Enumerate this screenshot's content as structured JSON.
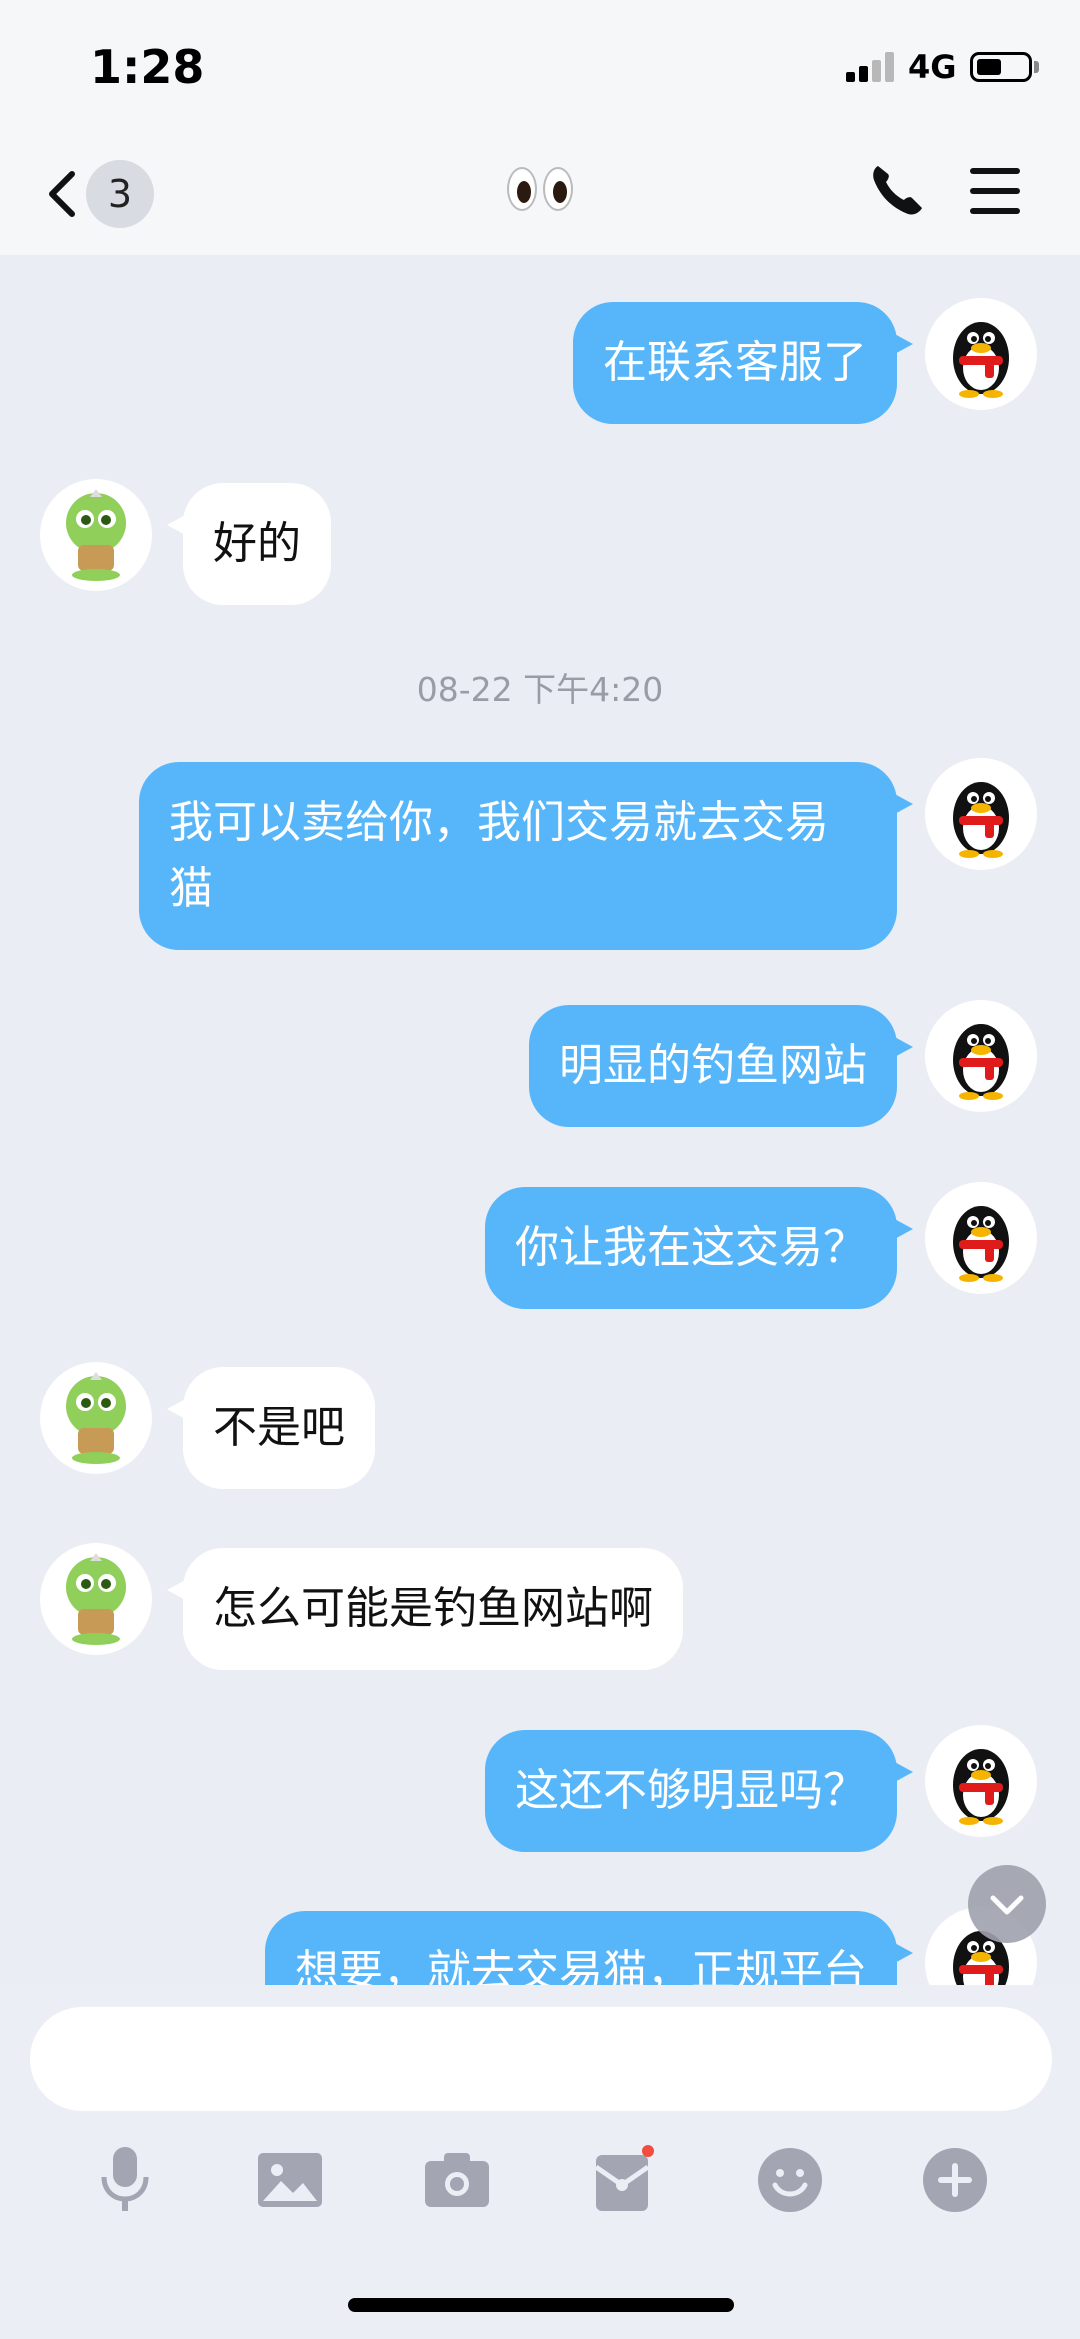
{
  "status_bar": {
    "time": "1:28",
    "network": "4G"
  },
  "nav": {
    "unread_count": "3",
    "title_icon": "eyes-emoji"
  },
  "messages": [
    {
      "side": "out",
      "text": "在联系客服了"
    },
    {
      "side": "in",
      "text": "好的"
    },
    {
      "type": "timestamp",
      "text": "08-22 下午4:20"
    },
    {
      "side": "out",
      "text": "我可以卖给你，我们交易就去交易猫"
    },
    {
      "side": "out",
      "text": "明显的钓鱼网站"
    },
    {
      "side": "out",
      "text": "你让我在这交易？"
    },
    {
      "side": "in",
      "text": "不是吧"
    },
    {
      "side": "in",
      "text": "怎么可能是钓鱼网站啊"
    },
    {
      "side": "out",
      "text": "这还不够明显吗？"
    },
    {
      "side": "out",
      "text": "想要，就去交易猫，正规平台"
    }
  ],
  "input": {
    "placeholder": ""
  },
  "toolbar": {
    "icons": [
      "microphone-icon",
      "image-icon",
      "camera-icon",
      "red-packet-icon",
      "emoji-icon",
      "plus-icon"
    ]
  },
  "colors": {
    "out_bubble": "#57b6fa",
    "in_bubble": "#ffffff",
    "background": "#ebedf5"
  }
}
